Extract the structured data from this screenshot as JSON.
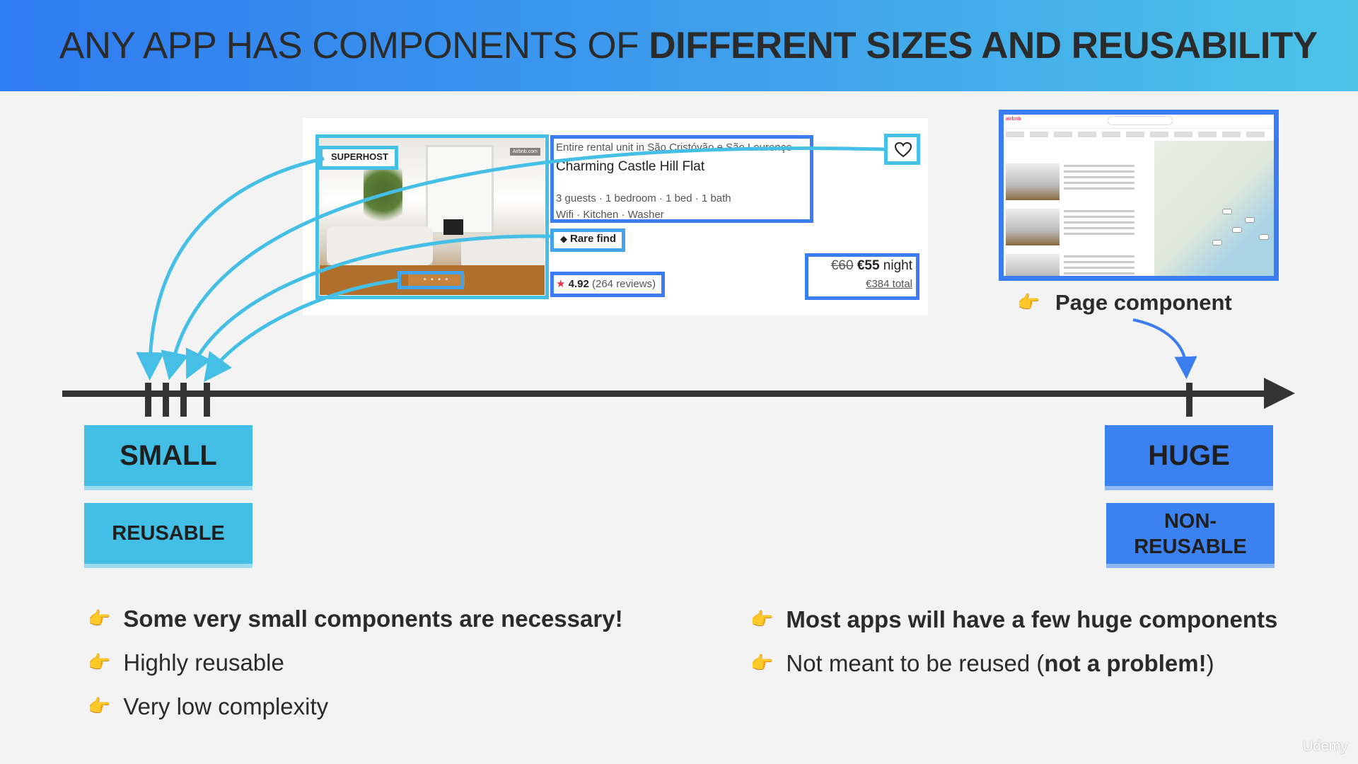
{
  "header": {
    "title_plain": "ANY APP HAS COMPONENTS OF ",
    "title_bold": "DIFFERENT SIZES AND REUSABILITY"
  },
  "listing_card": {
    "badge": "SUPERHOST",
    "photo_brand": "Airbnb.com",
    "photo_dots": "• • • •",
    "subtitle": "Entire rental unit in São Cristóvão e São Lourenço",
    "title": "Charming Castle Hill Flat",
    "details": "3 guests · 1 bedroom · 1 bed · 1 bath",
    "amenities": "Wifi · Kitchen · Washer",
    "rare_find": "Rare find",
    "rating_value": "4.92",
    "rating_reviews": "(264 reviews)",
    "price_old": "€60",
    "price_new": "€55",
    "price_unit": "night",
    "price_total": "€384 total"
  },
  "page_component": {
    "thumbnail_logo": "airbnb",
    "label": "Page component"
  },
  "timeline": {
    "small_label": "SMALL",
    "small_sub": "REUSABLE",
    "huge_label": "HUGE",
    "huge_sub_line1": "NON-",
    "huge_sub_line2": "REUSABLE"
  },
  "left_bullets": [
    {
      "text": "Some very small components are necessary!",
      "bold": true
    },
    {
      "text": "Highly reusable",
      "bold": false
    },
    {
      "text": "Very low complexity",
      "bold": false
    }
  ],
  "right_bullets": {
    "first": "Most apps will have a few huge components",
    "second_plain": "Not meant to be reused (",
    "second_bold": "not a problem!",
    "second_end": ")"
  },
  "watermark": "Udemy",
  "icons": {
    "pointer": "pointing-hand-icon",
    "heart": "heart-icon",
    "star": "star-icon",
    "gem": "diamond-icon"
  },
  "colors": {
    "header_start": "#2f7bf0",
    "header_end": "#4cc4e8",
    "small_accent": "#43bfe6",
    "huge_accent": "#3b82f0",
    "axis": "#333333"
  }
}
